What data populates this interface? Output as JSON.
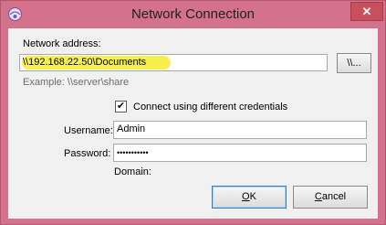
{
  "window": {
    "title": "Network Connection",
    "close_glyph": "✕"
  },
  "form": {
    "network_address_label": "Network address:",
    "network_address_value": "\\\\192.168.22.50\\Documents",
    "browse_button": "\\\\...",
    "example_hint": "Example: \\\\server\\share",
    "credentials_checkbox_label": "Connect using different credentials",
    "credentials_checked": true,
    "check_glyph": "✔",
    "username_label": "Username:",
    "username_value": "Admin",
    "password_label": "Password:",
    "password_value": "•••••••••••",
    "domain_label": "Domain:"
  },
  "buttons": {
    "ok_mnemonic": "O",
    "ok_rest": "K",
    "cancel_mnemonic": "C",
    "cancel_rest": "ancel"
  },
  "colors": {
    "frame": "#d4728b",
    "close": "#c7505b",
    "highlight": "#f7f04a"
  },
  "icons": {
    "app": "network-app-icon",
    "close": "close-icon"
  }
}
